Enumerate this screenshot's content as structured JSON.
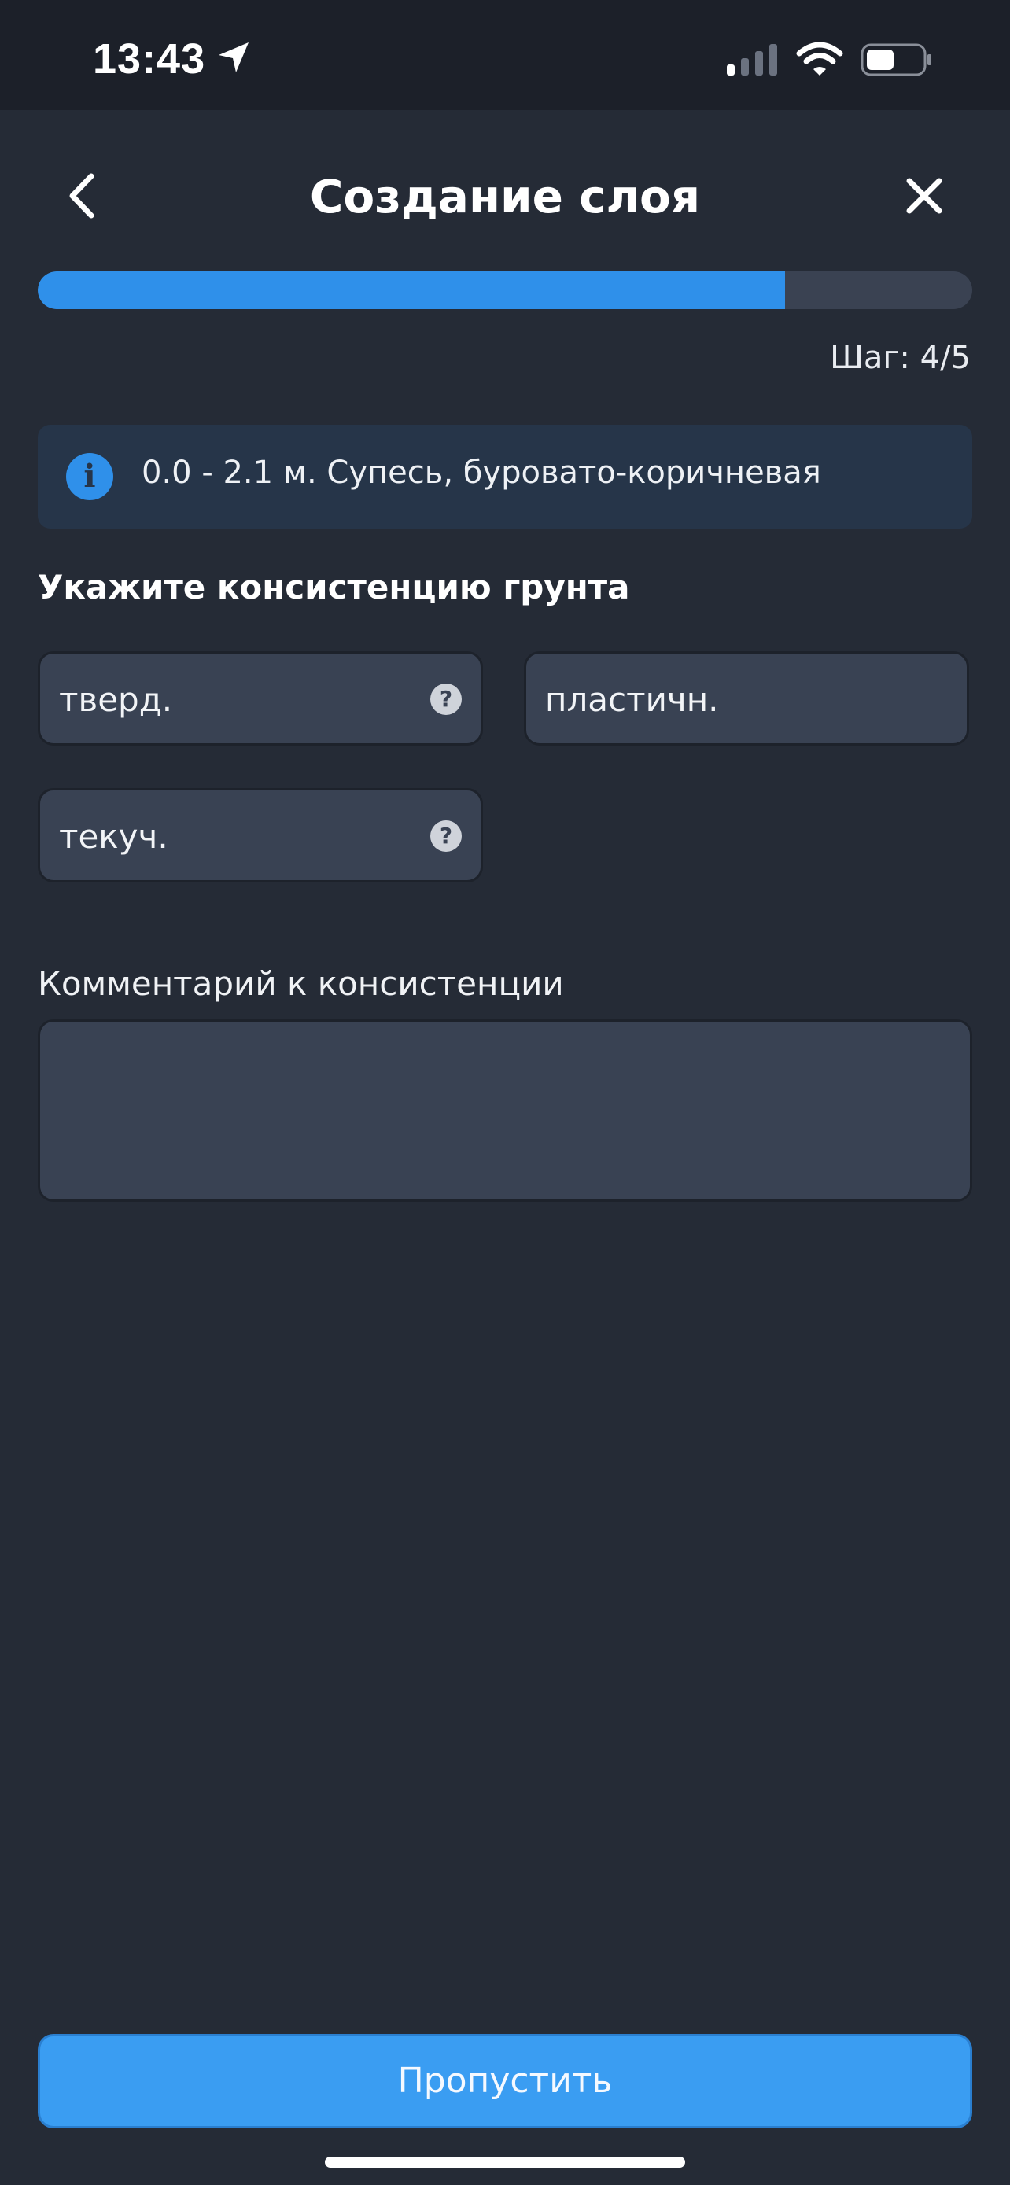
{
  "status_bar": {
    "time": "13:43",
    "icons": [
      "location-arrow-icon",
      "cellular-signal-icon",
      "wifi-icon",
      "battery-icon"
    ]
  },
  "header": {
    "title": "Создание слоя",
    "back_icon": "chevron-left-icon",
    "close_icon": "close-icon"
  },
  "progress": {
    "fraction": 0.8,
    "step_text": "Шаг: 4/5"
  },
  "info": {
    "icon": "info-icon",
    "text": "0.0 - 2.1 м. Супесь, буровато-коричневая"
  },
  "consistency": {
    "title": "Укажите консистенцию грунта",
    "options": [
      {
        "label": "тверд.",
        "has_help": true
      },
      {
        "label": "пластичн.",
        "has_help": false
      },
      {
        "label": "текуч.",
        "has_help": true
      }
    ],
    "help_glyph": "?"
  },
  "comment": {
    "label": "Комментарий к консистенции",
    "value": "",
    "placeholder": ""
  },
  "footer": {
    "skip_label": "Пропустить"
  },
  "colors": {
    "background": "#252b36",
    "status_bar": "#1c2029",
    "accent": "#2f90ea",
    "button": "#3a9df2",
    "field": "#394253",
    "info_box": "#263549"
  }
}
